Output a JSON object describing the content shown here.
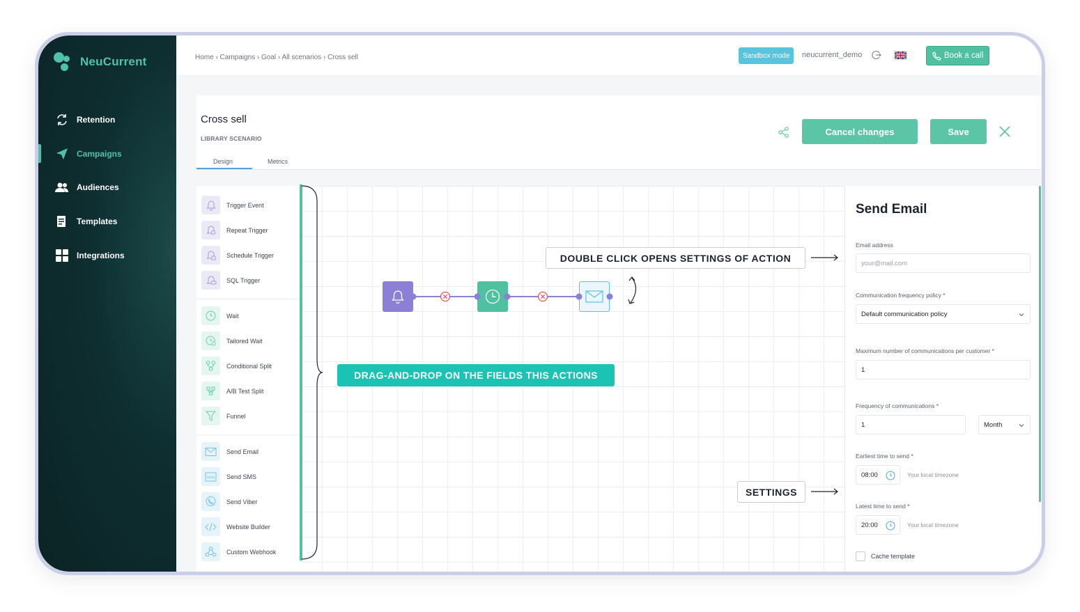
{
  "brand": {
    "name": "NeuCurrent"
  },
  "sidebar": {
    "items": [
      {
        "label": "Retention",
        "icon": "retention-cycle-icon"
      },
      {
        "label": "Campaigns",
        "icon": "paper-plane-icon",
        "active": true
      },
      {
        "label": "Audiences",
        "icon": "users-icon"
      },
      {
        "label": "Templates",
        "icon": "document-icon"
      },
      {
        "label": "Integrations",
        "icon": "grid-icon"
      }
    ]
  },
  "topbar": {
    "breadcrumb": "Home › Campaigns › Goal › All scenarios › Cross sell",
    "sandbox_label": "Sandbox mode",
    "username": "neucurrent_demo",
    "book_label": "Book a call"
  },
  "header": {
    "title": "Cross sell",
    "subtitle": "LIBRARY SCENARIO",
    "tabs": [
      {
        "label": "Design",
        "active": true
      },
      {
        "label": "Metrics"
      }
    ],
    "cancel_label": "Cancel changes",
    "save_label": "Save"
  },
  "palette": {
    "groups": [
      [
        {
          "label": "Trigger Event",
          "icon": "bell-icon"
        },
        {
          "label": "Repeat Trigger",
          "icon": "bell-repeat-icon"
        },
        {
          "label": "Schedule Trigger",
          "icon": "bell-schedule-icon"
        },
        {
          "label": "SQL Trigger",
          "icon": "bell-sql-icon"
        }
      ],
      [
        {
          "label": "Wait",
          "icon": "clock-icon"
        },
        {
          "label": "Tailored Wait",
          "icon": "tailored-clock-icon"
        },
        {
          "label": "Conditional Split",
          "icon": "split-icon"
        },
        {
          "label": "A/B Test Split",
          "icon": "ab-split-icon"
        },
        {
          "label": "Funnel",
          "icon": "funnel-icon"
        }
      ],
      [
        {
          "label": "Send Email",
          "icon": "envelope-icon"
        },
        {
          "label": "Send SMS",
          "icon": "sms-icon"
        },
        {
          "label": "Send Viber",
          "icon": "viber-icon"
        },
        {
          "label": "Website Builder",
          "icon": "code-icon"
        },
        {
          "label": "Custom Webhook",
          "icon": "webhook-icon"
        }
      ]
    ]
  },
  "callouts": {
    "double_click": "DOUBLE CLICK OPENS SETTINGS OF ACTION",
    "drag_drop": "DRAG-AND-DROP ON THE FIELDS THIS ACTIONS",
    "settings": "SETTINGS"
  },
  "panel": {
    "title": "Send Email",
    "email_label": "Email address",
    "email_placeholder": "your@mail.com",
    "policy_label": "Communication frequency policy *",
    "policy_value": "Default communication policy",
    "max_label": "Maximum number of communications per customer *",
    "max_value": "1",
    "freq_label": "Frequency of communications *",
    "freq_value": "1",
    "freq_unit": "Month",
    "earliest_label": "Earliest time to send *",
    "earliest_value": "08:00",
    "latest_label": "Latest time to send *",
    "latest_value": "20:00",
    "timezone": "Your local timezone",
    "cache_label": "Cache template"
  },
  "colors": {
    "accent": "#4fc1a0",
    "sidebar": "#0e2e30",
    "trigger": "#8c7fd6",
    "wait": "#4fc1a0",
    "email": "#5ac4df"
  }
}
